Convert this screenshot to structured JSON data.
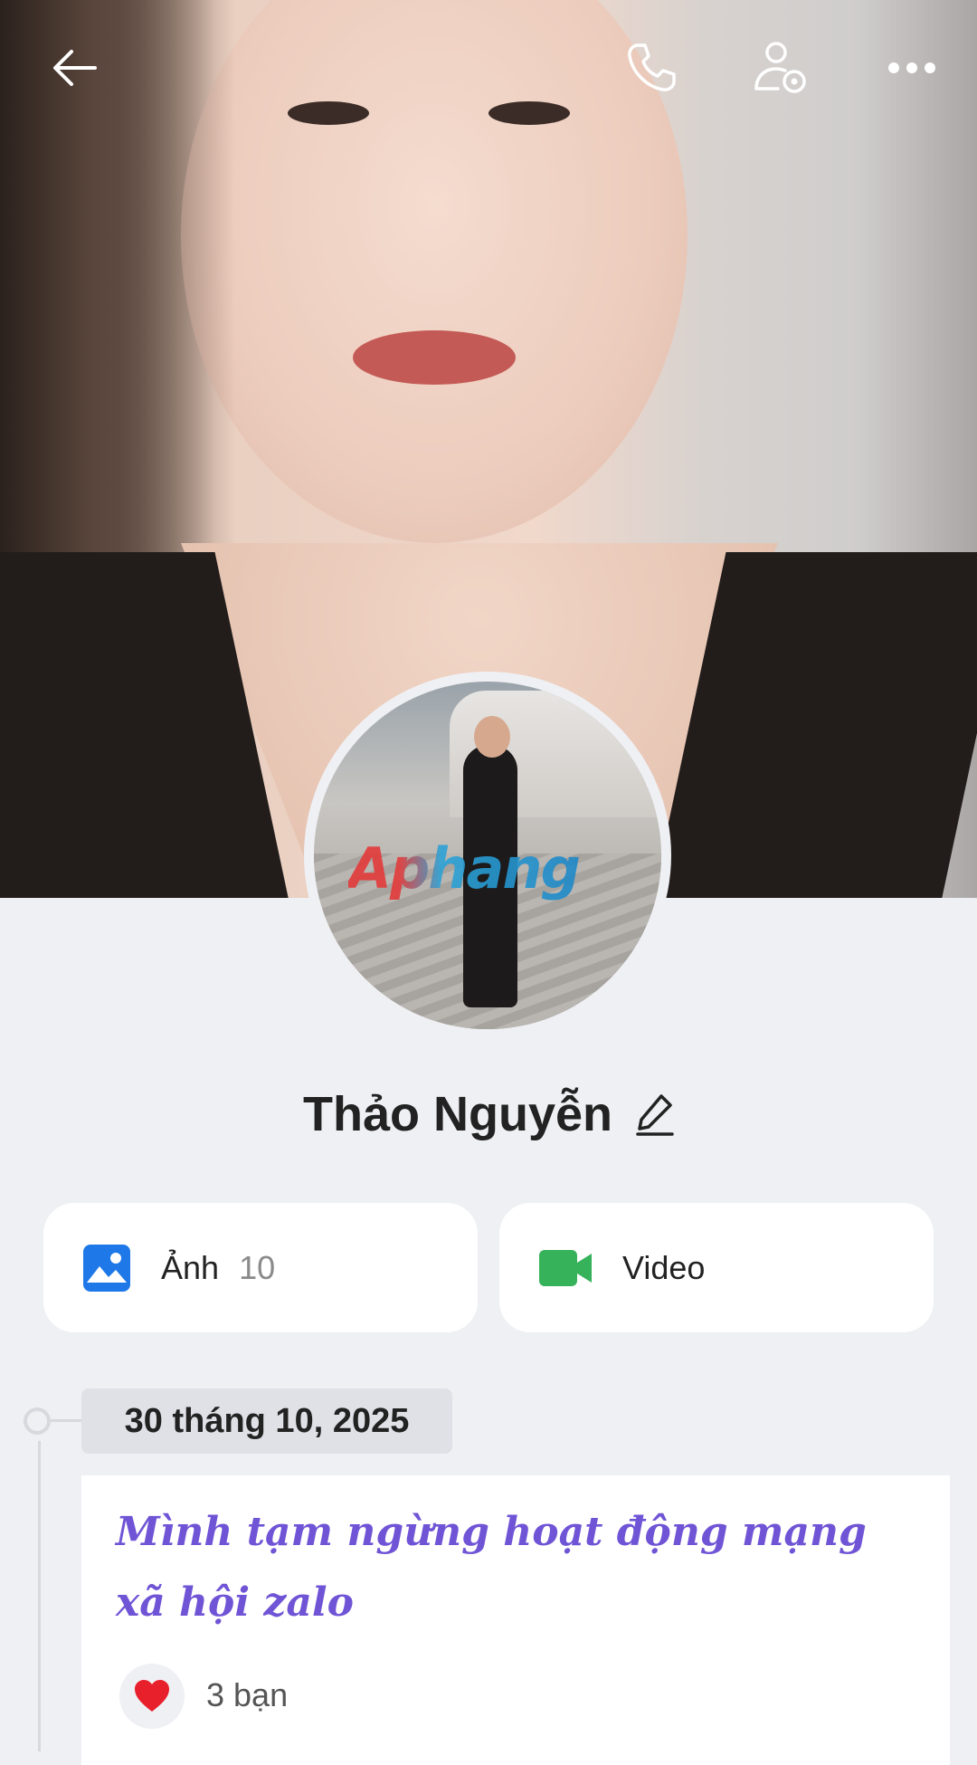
{
  "profile": {
    "name": "Thảo Nguyễn"
  },
  "media": {
    "photos_label": "Ảnh",
    "photos_count": "10",
    "video_label": "Video"
  },
  "avatar": {
    "watermark": "Aphang"
  },
  "timeline": {
    "date": "30 tháng 10, 2025",
    "post_text": "Mình tạm ngừng hoạt động mạng xã hội zalo",
    "reactions": "3 bạn"
  },
  "icons": {
    "back": "back-arrow-icon",
    "call": "phone-icon",
    "settings": "user-settings-icon",
    "more": "more-icon",
    "edit": "pencil-icon",
    "photo": "image-icon",
    "video": "video-camera-icon",
    "heart": "heart-icon"
  },
  "colors": {
    "photo_icon": "#1e78e8",
    "video_icon": "#35b25a",
    "post_text": "#7054d6",
    "heart": "#e8202c"
  }
}
